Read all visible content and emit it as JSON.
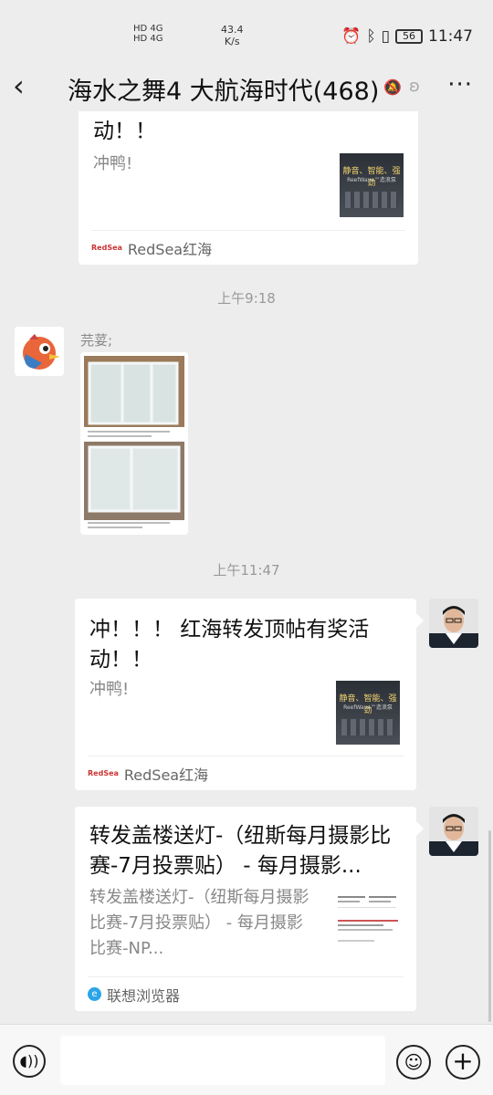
{
  "status": {
    "net_line1": "HD 4G",
    "net_line2": "HD 4G",
    "speed_value": "43.4",
    "speed_unit": "K/s",
    "battery": "56",
    "time": "11:47"
  },
  "header": {
    "title": "海水之舞4 大航海时代(468)",
    "back_icon": "back-arrow-icon",
    "more_label": "···"
  },
  "messages": {
    "card1": {
      "title": "动！！",
      "desc": "冲鸭!",
      "thumb_line1": "静音、智能、强劲",
      "thumb_line2": "ReefWave™造浪泵",
      "source_logo": "RedSea",
      "source": "RedSea红海"
    },
    "time1": "上午9:18",
    "sender1": "芫荽;",
    "time2": "上午11:47",
    "card2": {
      "title": "冲！！！ 红海转发顶帖有奖活动！！",
      "desc": "冲鸭!",
      "thumb_line1": "静音、智能、强劲",
      "thumb_line2": "ReefWave™造浪泵",
      "source_logo": "RedSea",
      "source": "RedSea红海"
    },
    "card3": {
      "title": "转发盖楼送灯-（纽斯每月摄影比赛-7月投票贴） - 每月摄影...",
      "desc": "转发盖楼送灯-（纽斯每月摄影比赛-7月投票贴） - 每月摄影比赛-NP...",
      "source": "联想浏览器"
    }
  },
  "input": {
    "voice_icon": "voice-icon",
    "emoji_icon": "emoji-icon",
    "plus_icon": "plus-icon"
  }
}
